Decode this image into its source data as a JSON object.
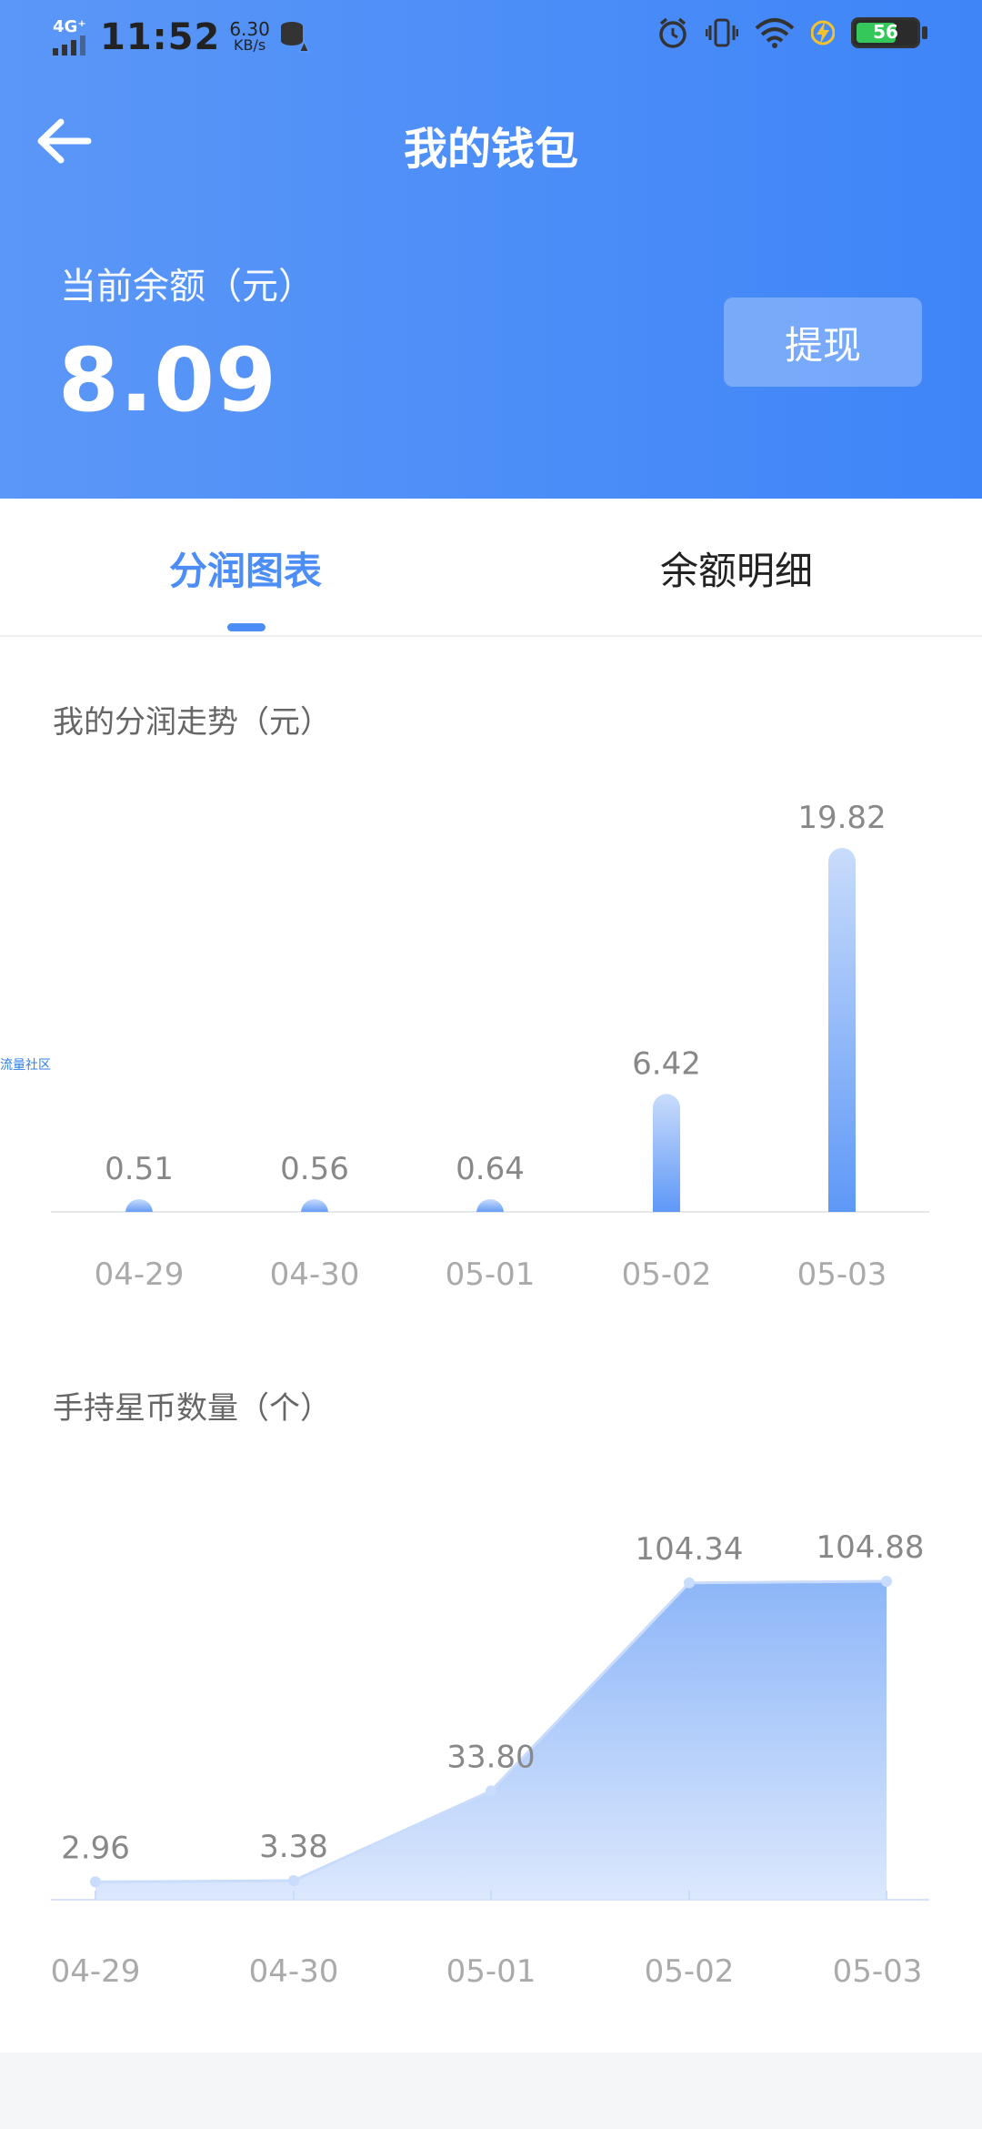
{
  "status_bar": {
    "network": "4G⁺",
    "time": "11:52",
    "speed_value": "6.30",
    "speed_unit": "KB/s",
    "battery": "56"
  },
  "nav": {
    "title": "我的钱包"
  },
  "balance": {
    "label": "当前余额（元）",
    "value": "8.09",
    "withdraw_label": "提现"
  },
  "tabs": [
    {
      "label": "分润图表",
      "active": true
    },
    {
      "label": "余额明细",
      "active": false
    }
  ],
  "sections": {
    "profit_title": "我的分润走势（元）",
    "coins_title": "手持星币数量（个）",
    "watermark": "流量社区"
  },
  "colors": {
    "header_start": "#5B97F7",
    "header_end": "#3F85F8",
    "accent": "#4C8DF6"
  },
  "chart_data": [
    {
      "type": "bar",
      "categories": [
        "04-29",
        "04-30",
        "05-01",
        "05-02",
        "05-03"
      ],
      "values": [
        0.51,
        0.56,
        0.64,
        6.42,
        19.82
      ],
      "value_labels": [
        "0.51",
        "0.56",
        "0.64",
        "6.42",
        "19.82"
      ],
      "title": "我的分润走势（元）",
      "ylim": [
        0,
        19.82
      ],
      "grid": false
    },
    {
      "type": "area",
      "categories": [
        "04-29",
        "04-30",
        "05-01",
        "05-02",
        "05-03"
      ],
      "values": [
        2.96,
        3.38,
        33.8,
        104.34,
        104.88
      ],
      "value_labels": [
        "2.96",
        "3.38",
        "33.80",
        "104.34",
        "104.88"
      ],
      "title": "手持星币数量（个）",
      "ylim": [
        0,
        104.88
      ],
      "grid": false
    }
  ]
}
